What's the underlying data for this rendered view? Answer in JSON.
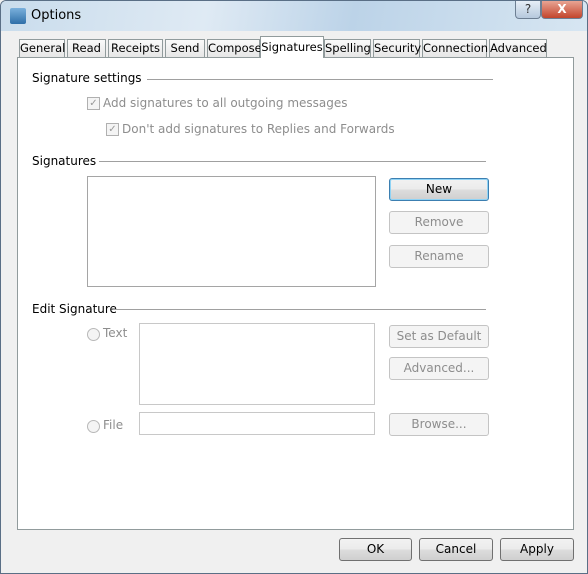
{
  "window": {
    "title": "Options",
    "help_label": "?",
    "close_label": "X"
  },
  "tabs": [
    "General",
    "Read",
    "Receipts",
    "Send",
    "Compose",
    "Signatures",
    "Spelling",
    "Security",
    "Connection",
    "Advanced"
  ],
  "selected_tab": "Signatures",
  "signature_settings": {
    "heading": "Signature settings",
    "add_to_all": {
      "label": "Add signatures to all outgoing messages",
      "checked": true,
      "enabled": false
    },
    "no_replies": {
      "label": "Don't add signatures to Replies and Forwards",
      "checked": true,
      "enabled": false
    }
  },
  "signatures": {
    "heading": "Signatures",
    "items": [],
    "new_label": "New",
    "remove_label": "Remove",
    "rename_label": "Rename"
  },
  "edit_signature": {
    "heading": "Edit Signature",
    "text_label": "Text",
    "file_label": "File",
    "text_value": "",
    "file_value": "",
    "set_default_label": "Set as Default",
    "advanced_label": "Advanced...",
    "browse_label": "Browse..."
  },
  "footer": {
    "ok_label": "OK",
    "cancel_label": "Cancel",
    "apply_label": "Apply"
  }
}
